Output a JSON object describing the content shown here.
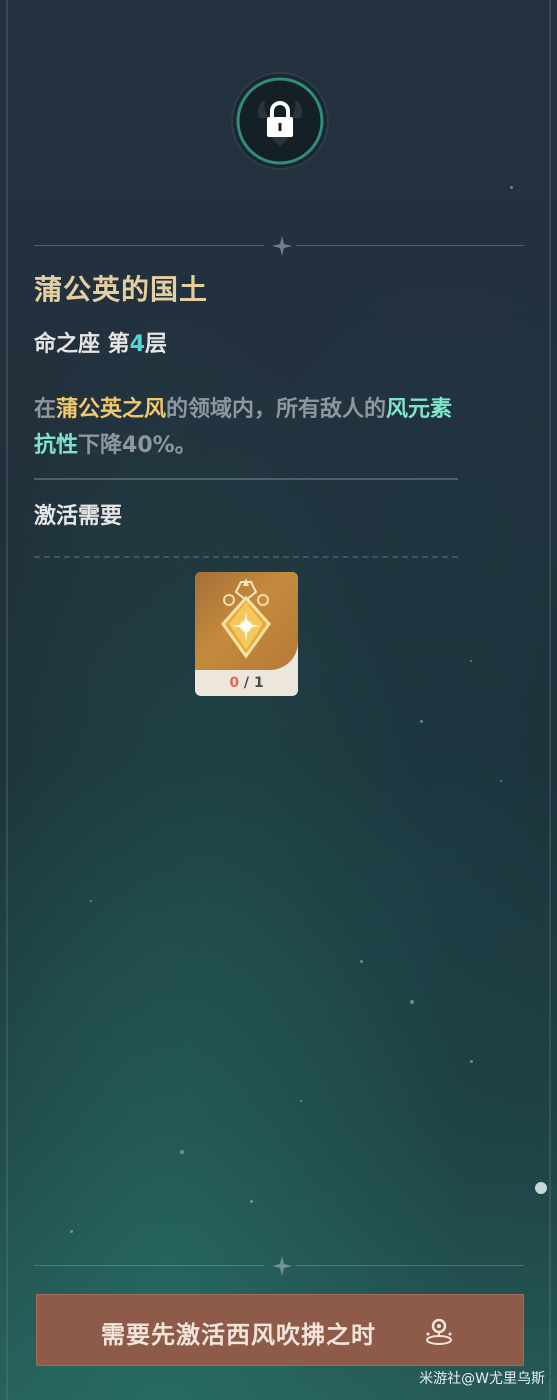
{
  "constellation": {
    "name": "蒲公英的国土",
    "level_prefix": "命之座 第",
    "level_num": "4",
    "level_suffix": "层",
    "locked": true,
    "lock_icon": "padlock-icon"
  },
  "description": {
    "part1": "在",
    "highlight1": "蒲公英之风",
    "part2": "的领域内，所有敌人的",
    "highlight2": "风元素抗性",
    "part3": "下降40%。"
  },
  "requirements": {
    "label": "激活需要",
    "item": {
      "icon": "constellation-star-stone-icon",
      "have": "0",
      "sep": " / ",
      "need": "1"
    }
  },
  "action": {
    "label": "需要先激活西风吹拂之时",
    "icon": "constellation-node-icon"
  },
  "watermark": "米游社@W尤里乌斯",
  "colors": {
    "gold": "#f2c86e",
    "wind": "#7ee6c8",
    "level_accent": "#4fd6d8",
    "button_bg": "#8e5a4a"
  }
}
